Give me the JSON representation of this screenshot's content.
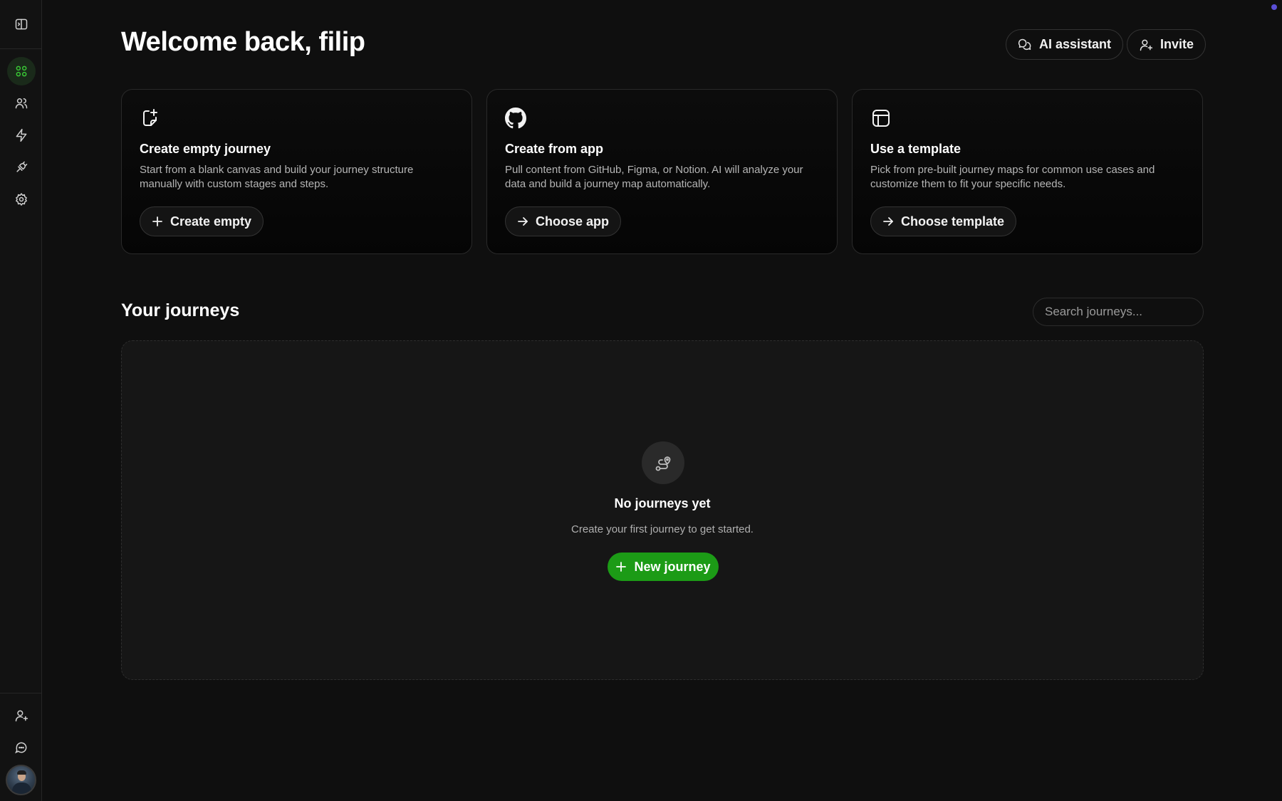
{
  "header": {
    "title": "Welcome back, filip",
    "ai_assistant_label": "AI assistant",
    "invite_label": "Invite"
  },
  "sidebar": {
    "items": [
      {
        "icon": "panel-toggle-icon"
      },
      {
        "icon": "dashboard-grid-icon",
        "active": true
      },
      {
        "icon": "users-icon"
      },
      {
        "icon": "lightning-icon"
      },
      {
        "icon": "plug-icon"
      },
      {
        "icon": "gear-icon"
      }
    ],
    "bottom_items": [
      {
        "icon": "add-user-icon"
      },
      {
        "icon": "chat-icon"
      },
      {
        "icon": "avatar"
      }
    ]
  },
  "cards": [
    {
      "icon": "new-document-icon",
      "title": "Create empty journey",
      "description": "Start from a blank canvas and build your journey structure manually with custom stages and steps.",
      "button_label": "Create empty",
      "button_icon": "plus-icon"
    },
    {
      "icon": "github-icon",
      "title": "Create from app",
      "description": "Pull content from GitHub, Figma, or Notion. AI will analyze your data and build a journey map automatically.",
      "button_label": "Choose app",
      "button_icon": "arrow-right-icon"
    },
    {
      "icon": "template-layout-icon",
      "title": "Use a template",
      "description": "Pick from pre-built journey maps for common use cases and customize them to fit your specific needs.",
      "button_label": "Choose template",
      "button_icon": "arrow-right-icon"
    }
  ],
  "journeys": {
    "section_title": "Your journeys",
    "search_placeholder": "Search journeys...",
    "empty_title": "No journeys yet",
    "empty_subtitle": "Create your first journey to get started.",
    "new_button_label": "New journey"
  },
  "colors": {
    "background": "#0f0f0f",
    "accent_green": "#1c9b16",
    "active_icon_green": "#39c735",
    "notification_dot": "#5b4fd6"
  }
}
